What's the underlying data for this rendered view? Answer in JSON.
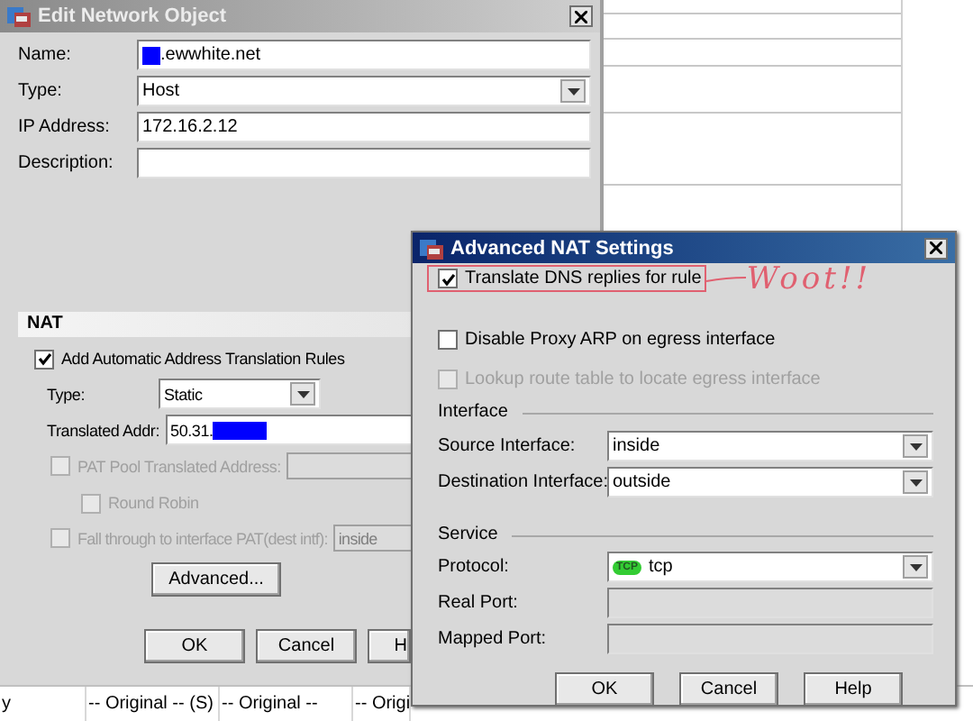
{
  "background_table": {
    "bottom_row": [
      "y",
      "-- Original -- (S)",
      "-- Original --",
      "-- Origi"
    ]
  },
  "edit_dialog": {
    "title": "Edit Network Object",
    "fields": [
      {
        "label": "Name:",
        "kind": "text",
        "value": ".ewwhite.net",
        "redacted": true
      },
      {
        "label": "Type:",
        "kind": "select",
        "value": "Host"
      },
      {
        "label": "IP Address:",
        "kind": "text",
        "value": "172.16.2.12"
      },
      {
        "label": "Description:",
        "kind": "text"
      }
    ],
    "nat": {
      "title": "NAT",
      "auto_rules": {
        "label": "Add Automatic Address Translation Rules",
        "checked": true,
        "disabled": false
      },
      "type": {
        "label": "Type:",
        "value": "Static"
      },
      "translated_addr": {
        "label": "Translated Addr:",
        "value": "50.31.",
        "redacted": true
      },
      "pat_pool": {
        "label": "PAT Pool Translated Address:",
        "checked": false,
        "disabled": true
      },
      "round_robin": {
        "label": "Round Robin",
        "checked": false,
        "disabled": true
      },
      "fall_through": {
        "label": "Fall through to interface PAT(dest intf):",
        "checked": false,
        "disabled": true,
        "value": "inside"
      },
      "advanced_button": "Advanced..."
    },
    "buttons": [
      "OK",
      "Cancel",
      "H"
    ]
  },
  "advanced_dialog": {
    "title": "Advanced NAT Settings",
    "options": [
      {
        "label": "Translate DNS replies for rule",
        "checked": true,
        "disabled": false,
        "highlighted": true
      },
      {
        "label": "Disable Proxy ARP on egress interface",
        "checked": false,
        "disabled": false,
        "highlighted": false
      },
      {
        "label": "Lookup route table to locate egress interface",
        "checked": false,
        "disabled": true,
        "highlighted": false
      }
    ],
    "annotation": "Woot!!",
    "interface": {
      "title": "Interface",
      "fields": [
        {
          "label": "Source Interface:",
          "kind": "select",
          "value": "inside"
        },
        {
          "label": "Destination Interface:",
          "kind": "select",
          "value": "outside"
        }
      ]
    },
    "service": {
      "title": "Service",
      "fields": [
        {
          "label": "Protocol:",
          "kind": "select",
          "value": "tcp",
          "badge": "TCP"
        },
        {
          "label": "Real Port:",
          "kind": "text",
          "disabled": true
        },
        {
          "label": "Mapped Port:",
          "kind": "text",
          "disabled": true
        }
      ]
    },
    "buttons": [
      "OK",
      "Cancel",
      "Help"
    ]
  }
}
